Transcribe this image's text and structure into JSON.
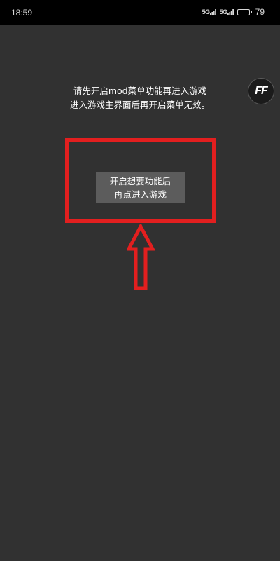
{
  "status_bar": {
    "time": "18:59",
    "signal_1": "5G",
    "signal_2": "5G",
    "battery_level": "79",
    "battery_fraction": 0.79,
    "icons": [
      "signal-icon",
      "signal-icon",
      "battery-icon"
    ]
  },
  "overlay_badge": {
    "label": "FF"
  },
  "instruction": {
    "line1": "请先开启mod菜单功能再进入游戏",
    "line2": "进入游戏主界面后再开启菜单无效。"
  },
  "start_button": {
    "line1": "开启想要功能后",
    "line2": "再点进入游戏"
  },
  "annotation": {
    "color": "#e21f1f",
    "icons": [
      "up-arrow-icon"
    ]
  }
}
